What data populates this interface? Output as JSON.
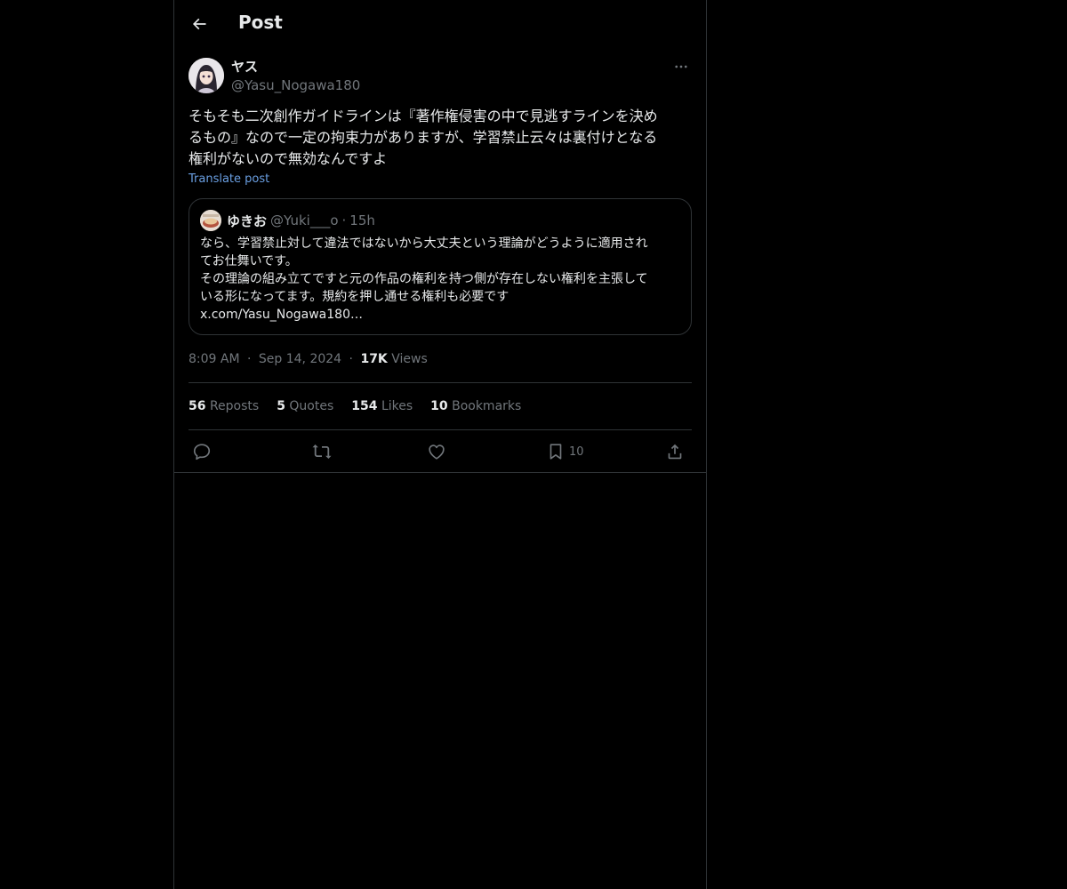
{
  "header": {
    "title": "Post",
    "back_icon": "arrow-left-icon"
  },
  "post": {
    "author_name": "ヤス",
    "author_handle": "@Yasu_Nogawa180",
    "text": "そもそも二次創作ガイドラインは『著作権侵害の中で見逃すラインを決め\nるもの』なので一定の拘束力がありますが、学習禁止云々は裏付けとなる\n権利がないので無効なんですよ",
    "translate_label": "Translate post",
    "time": "8:09 AM",
    "date": "Sep 14, 2024",
    "views_count": "17K",
    "views_label": "Views"
  },
  "quote": {
    "name": "ゆきお",
    "handle": "@Yuki___o",
    "separator": "·",
    "time": "15h",
    "lines": [
      "なら、学習禁止対して違法ではないから大丈夫という理論がどうように適用され",
      "てお仕舞いです。",
      "その理論の組み立てですと元の作品の権利を持つ側が存在しない権利を主張して",
      "いる形になってます。規約を押し通せる権利も必要です",
      "x.com/Yasu_Nogawa180…"
    ]
  },
  "meta_separator": "·",
  "stats": {
    "reposts": {
      "count": "56",
      "label": "Reposts"
    },
    "quotes": {
      "count": "5",
      "label": "Quotes"
    },
    "likes": {
      "count": "154",
      "label": "Likes"
    },
    "bookmarks": {
      "count": "10",
      "label": "Bookmarks"
    }
  },
  "actions": {
    "reply_icon": "reply-icon",
    "repost_icon": "repost-icon",
    "like_icon": "heart-icon",
    "bookmark_icon": "bookmark-icon",
    "bookmark_count": "10",
    "share_icon": "share-icon"
  },
  "colors": {
    "background": "#000000",
    "text": "#e7e9ea",
    "secondary_text": "#71767b",
    "border": "#2f3336",
    "link": "#6a9fe2"
  }
}
